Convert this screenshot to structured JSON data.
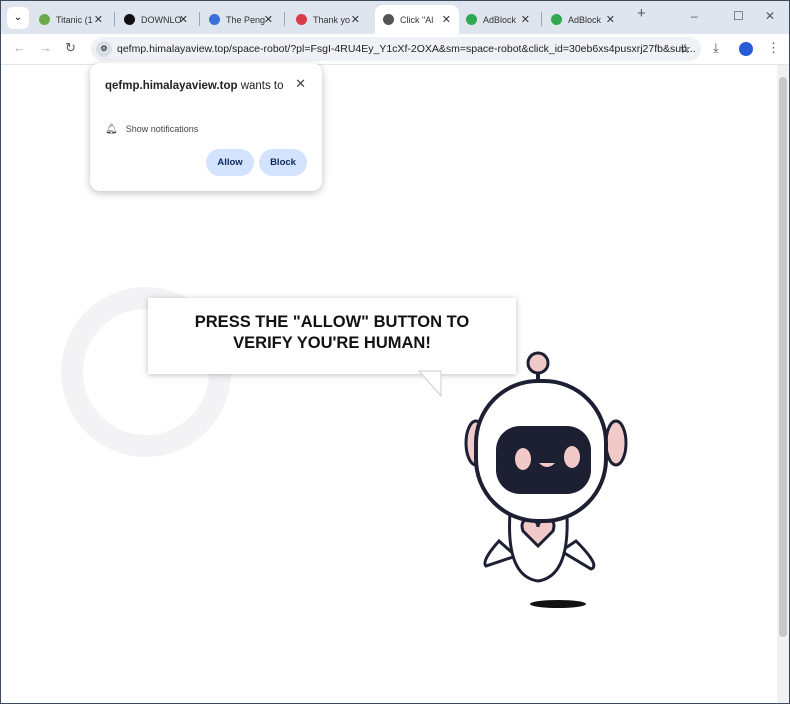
{
  "tabs": [
    {
      "label": "Titanic (1",
      "icon": "titanic-icon",
      "color": "#6aaa4a"
    },
    {
      "label": "DOWNLO",
      "icon": "download-site-icon",
      "color": "#111"
    },
    {
      "label": "The Peng",
      "icon": "loading-spinner-icon",
      "color": "#3a6fd8"
    },
    {
      "label": "Thank yo",
      "icon": "opera-icon",
      "color": "#d93a4a"
    },
    {
      "label": "Click \"Al",
      "icon": "robot-icon",
      "color": "#555",
      "active": true
    },
    {
      "label": "AdBlock",
      "icon": "shield-icon",
      "color": "#2fa84f"
    },
    {
      "label": "AdBlock",
      "icon": "shield-icon",
      "color": "#2fa84f"
    }
  ],
  "url": "qefmp.himalayaview.top/space-robot/?pl=FsgI-4RU4Ey_Y1cXf-2OXA&sm=space-robot&click_id=30eb6xs4pusxrj27fb&sub...",
  "popup": {
    "site": "qefmp.himalayaview.top",
    "wants": " wants to",
    "permission": "Show notifications",
    "allow": "Allow",
    "block": "Block"
  },
  "page": {
    "message": "PRESS THE \"ALLOW\" BUTTON TO VERIFY YOU'RE HUMAN!"
  }
}
